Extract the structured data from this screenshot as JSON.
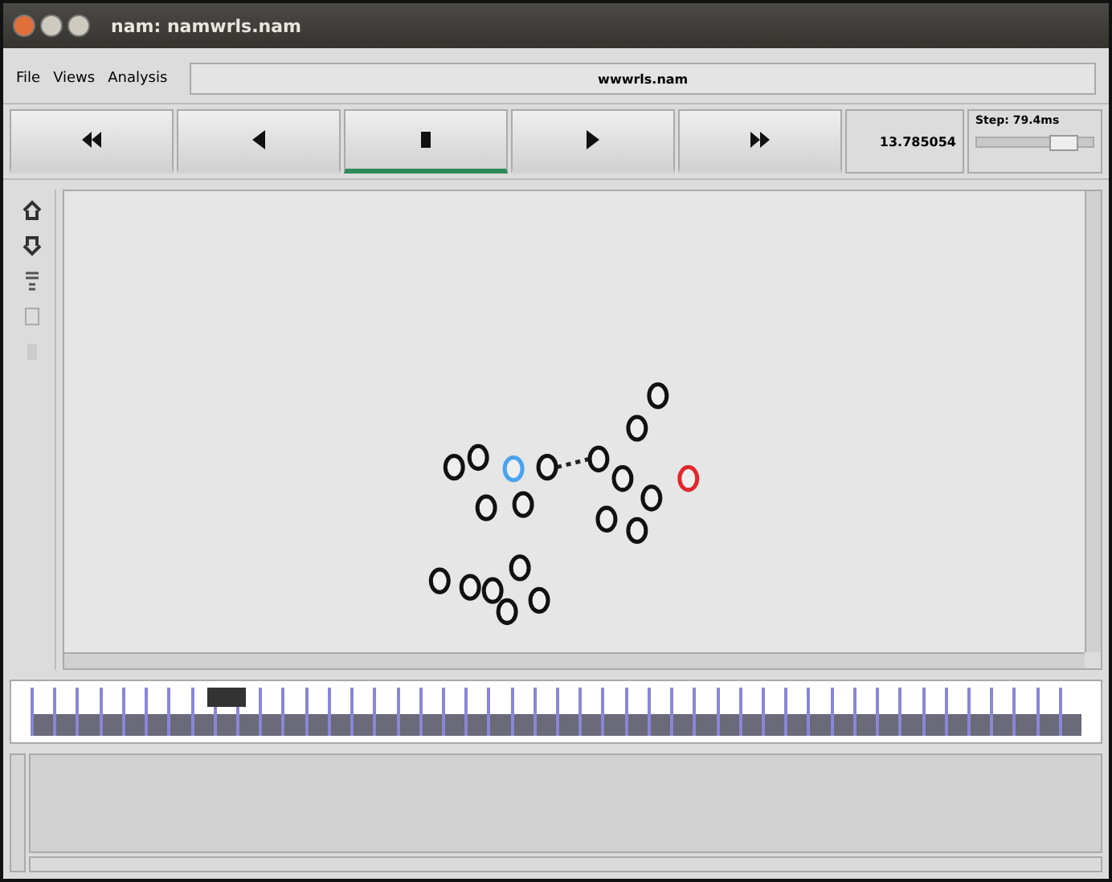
{
  "window": {
    "title": "nam: namwrls.nam"
  },
  "menu": [
    "File",
    "Views",
    "Analysis"
  ],
  "file_field": "wwwrls.nam",
  "controls": [
    {
      "kind": "rewind",
      "selected": false
    },
    {
      "kind": "back",
      "selected": false
    },
    {
      "kind": "stop",
      "selected": true
    },
    {
      "kind": "play",
      "selected": false
    },
    {
      "kind": "forward",
      "selected": false
    }
  ],
  "time": "13.785054",
  "step": {
    "label": "Step: 79.4ms",
    "level": 0.85
  },
  "nodes": [
    {
      "color": "#111111"
    },
    {
      "color": "#111111"
    },
    {
      "color": "#4aa3ef"
    },
    {
      "color": "#111111"
    },
    {
      "color": "#111111"
    },
    {
      "color": "#111111"
    },
    {
      "color": "#111111"
    },
    {
      "color": "#111111"
    },
    {
      "color": "#111111"
    },
    {
      "color": "#111111"
    },
    {
      "color": "#e0282e"
    },
    {
      "color": "#111111"
    },
    {
      "color": "#111111"
    },
    {
      "color": "#111111"
    },
    {
      "color": "#111111"
    },
    {
      "color": "#111111"
    },
    {
      "color": "#111111"
    },
    {
      "color": "#111111"
    },
    {
      "color": "#111111"
    },
    {
      "color": "#111111"
    }
  ],
  "timeline": {
    "level": 0.18
  }
}
